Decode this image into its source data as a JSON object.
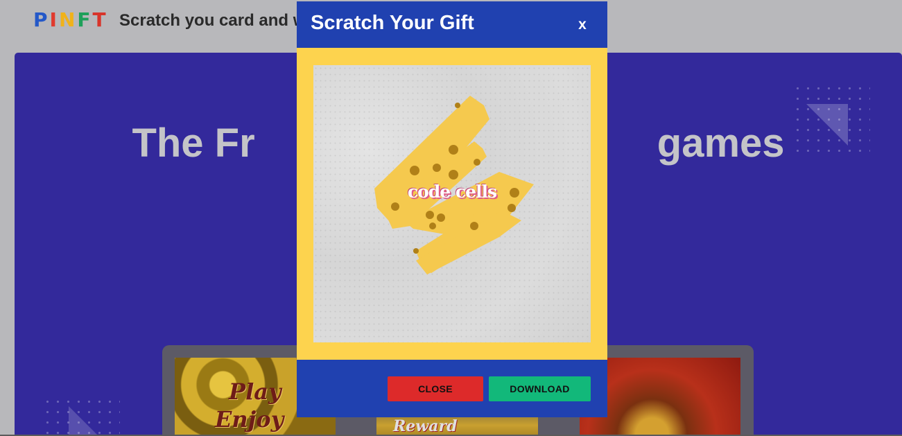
{
  "header": {
    "logo_letters": [
      {
        "char": "P",
        "color": "#2458c8"
      },
      {
        "char": "I",
        "color": "#e03a2e"
      },
      {
        "char": "N",
        "color": "#f0b21a"
      },
      {
        "char": "F",
        "color": "#1ea05a"
      },
      {
        "char": "T",
        "color": "#d8342a"
      }
    ],
    "tagline": "Scratch you card and w"
  },
  "hero": {
    "title": "The Fr                                    games",
    "background_color": "#33299b"
  },
  "cards": [
    {
      "label_line1": "Play",
      "label_line2": "Enjoy"
    },
    {
      "label": "Reward"
    },
    {
      "label": ""
    }
  ],
  "modal": {
    "title": "Scratch Your Gift",
    "close_symbol": "x",
    "scratch_code": "code cells",
    "buttons": {
      "close": "CLOSE",
      "download": "DOWNLOAD"
    },
    "colors": {
      "header": "#2041b0",
      "body": "#fdd34e",
      "close_button": "#dd2a2a",
      "download_button": "#12b87a"
    }
  }
}
